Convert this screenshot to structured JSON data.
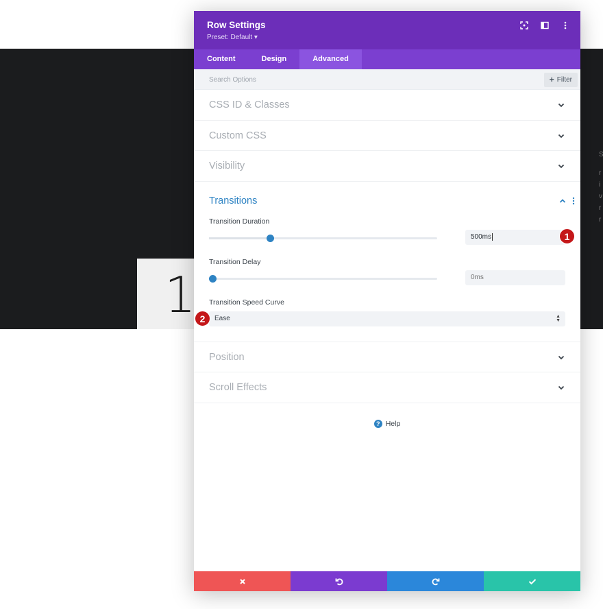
{
  "background": {
    "card_number": "1",
    "side_text": [
      "S",
      "r",
      "i",
      "v",
      "r",
      "r"
    ]
  },
  "modal": {
    "title": "Row Settings",
    "preset": "Preset: Default ▾",
    "tabs": [
      {
        "label": "Content",
        "active": false
      },
      {
        "label": "Design",
        "active": false
      },
      {
        "label": "Advanced",
        "active": true
      }
    ],
    "search": {
      "placeholder": "Search Options"
    },
    "filter_label": "Filter",
    "sections_top": [
      {
        "label": "CSS ID & Classes"
      },
      {
        "label": "Custom CSS"
      },
      {
        "label": "Visibility"
      }
    ],
    "transitions": {
      "title": "Transitions",
      "duration": {
        "label": "Transition Duration",
        "value": "500ms",
        "slider_fraction": 0.26
      },
      "delay": {
        "label": "Transition Delay",
        "placeholder": "0ms",
        "slider_fraction": 0.0
      },
      "speed_curve": {
        "label": "Transition Speed Curve",
        "value": "Ease"
      }
    },
    "sections_bottom": [
      {
        "label": "Position"
      },
      {
        "label": "Scroll Effects"
      }
    ],
    "help_label": "Help",
    "badges": [
      "1",
      "2"
    ],
    "colors": {
      "header": "#6c2eb9",
      "tabs": "#7b3fd0",
      "accent": "#2e83c3",
      "cancel": "#ef5555",
      "undo": "#7b3bd0",
      "redo": "#2b87da",
      "save": "#29c4a9"
    }
  }
}
